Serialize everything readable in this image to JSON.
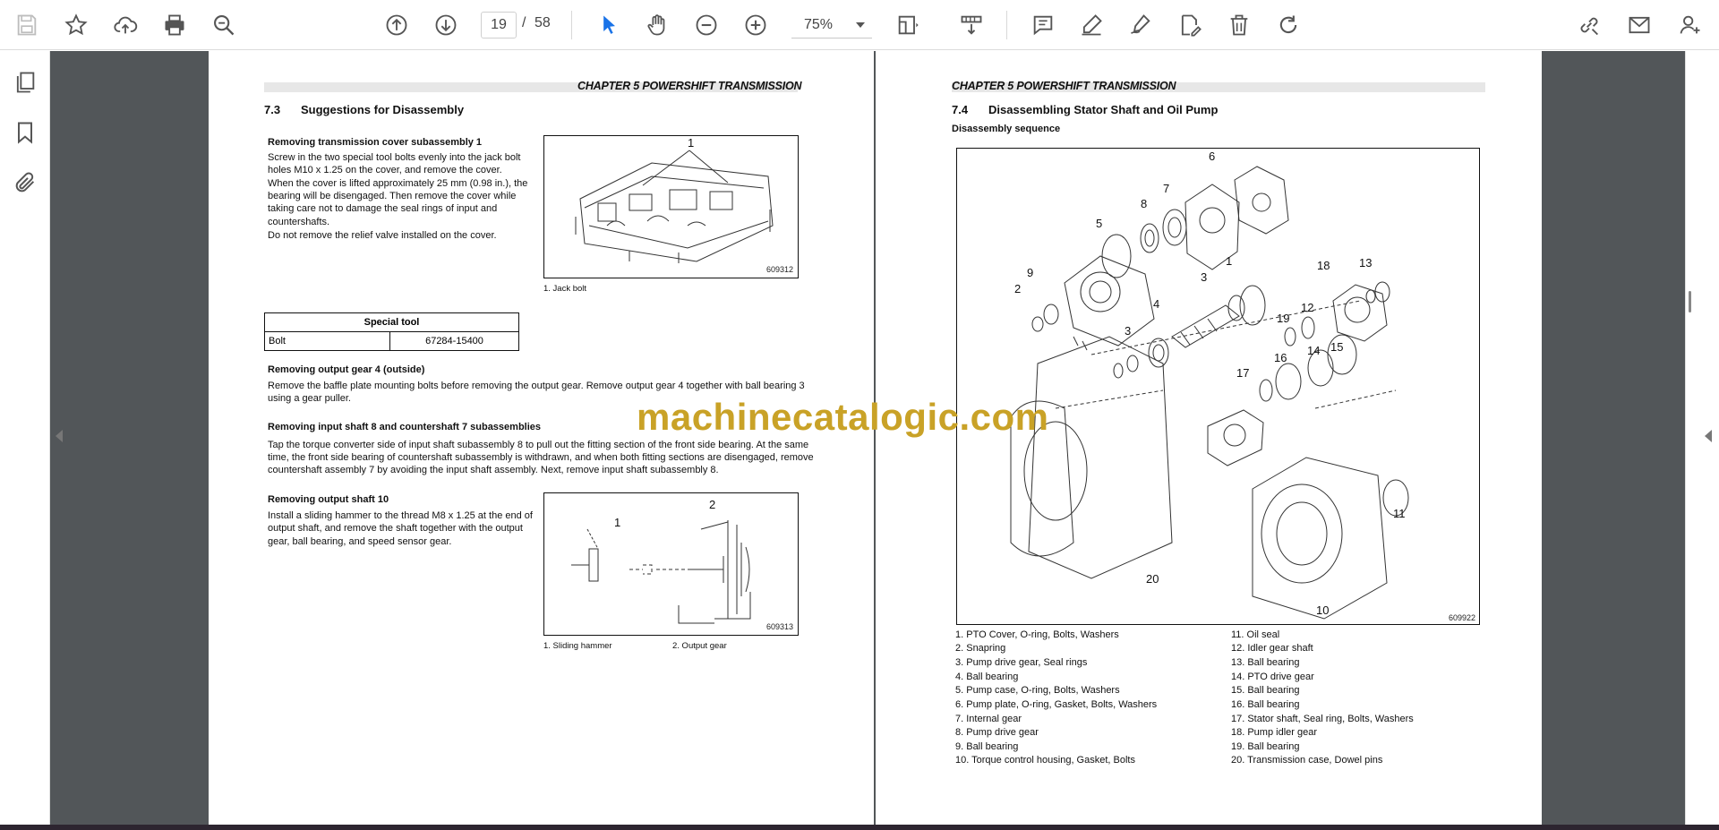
{
  "toolbar": {
    "current_page": "19",
    "page_separator": "/",
    "total_pages": "58",
    "zoom": "75%"
  },
  "left_page": {
    "chapter": "CHAPTER 5 POWERSHIFT TRANSMISSION",
    "section_num": "7.3",
    "section_title": "Suggestions for Disassembly",
    "s1_heading": "Removing transmission cover subassembly 1",
    "s1_lines": [
      "Screw in the two special tool bolts evenly into the jack bolt",
      "holes M10 x 1.25 on the cover, and remove the cover.",
      "When the cover is lifted approximately 25 mm (0.98 in.), the",
      "bearing will be disengaged. Then remove the cover while",
      "taking care not to damage the seal rings of input and",
      "countershafts.",
      "Do not remove the relief valve installed on the cover."
    ],
    "fig1_callout": "1",
    "fig1_code": "609312",
    "fig1_caption": "1.  Jack bolt",
    "table_header": "Special tool",
    "table_item": "Bolt",
    "table_part": "67284-15400",
    "s2_heading": "Removing output gear 4 (outside)",
    "s2_lines": [
      "Remove the baffle plate mounting bolts before removing the output gear. Remove output gear 4 together with ball bearing 3",
      "using a gear puller."
    ],
    "s3_heading": "Removing input shaft 8 and countershaft 7 subassemblies",
    "s3_lines": [
      "Tap the torque converter side of input shaft subassembly 8 to pull out the fitting section of the front side bearing. At the same",
      "time, the front side bearing of countershaft subassembly is withdrawn, and when both fitting sections are disengaged, remove",
      "countershaft assembly 7 by avoiding the input shaft assembly. Next, remove input shaft subassembly 8."
    ],
    "s4_heading": "Removing output shaft 10",
    "s4_lines": [
      "Install a sliding hammer to the thread M8 x 1.25 at the end of",
      "output shaft, and remove the shaft together with the output",
      "gear, ball bearing, and speed sensor gear."
    ],
    "fig2_callout1": "1",
    "fig2_callout2": "2",
    "fig2_code": "609313",
    "fig2_caption1": "1.  Sliding hammer",
    "fig2_caption2": "2.  Output gear"
  },
  "right_page": {
    "chapter": "CHAPTER 5 POWERSHIFT TRANSMISSION",
    "section_num": "7.4",
    "section_title": "Disassembling Stator Shaft and Oil Pump",
    "subheading": "Disassembly sequence",
    "fig_code": "609922",
    "callouts": [
      "6",
      "7",
      "8",
      "5",
      "9",
      "2",
      "3",
      "1",
      "18",
      "13",
      "4",
      "12",
      "3",
      "19",
      "15",
      "16",
      "14",
      "17",
      "11",
      "20",
      "10"
    ],
    "parts_left": [
      "1.    PTO Cover, O-ring, Bolts, Washers",
      "2.    Snapring",
      "3.    Pump drive gear, Seal rings",
      "4.    Ball bearing",
      "5.    Pump case, O-ring, Bolts, Washers",
      "6.    Pump plate, O-ring, Gasket, Bolts, Washers",
      "7.    Internal gear",
      "8.    Pump drive gear",
      "9.    Ball bearing",
      "10.  Torque control housing, Gasket, Bolts"
    ],
    "parts_right": [
      "11.   Oil seal",
      "12.   Idler gear shaft",
      "13.   Ball bearing",
      "14.   PTO drive gear",
      "15.   Ball bearing",
      "16.   Ball bearing",
      "17.   Stator shaft, Seal ring, Bolts, Washers",
      "18.   Pump idler gear",
      "19.   Ball bearing",
      "20.   Transmission case, Dowel pins"
    ]
  },
  "watermark": "machinecatalogic.com"
}
